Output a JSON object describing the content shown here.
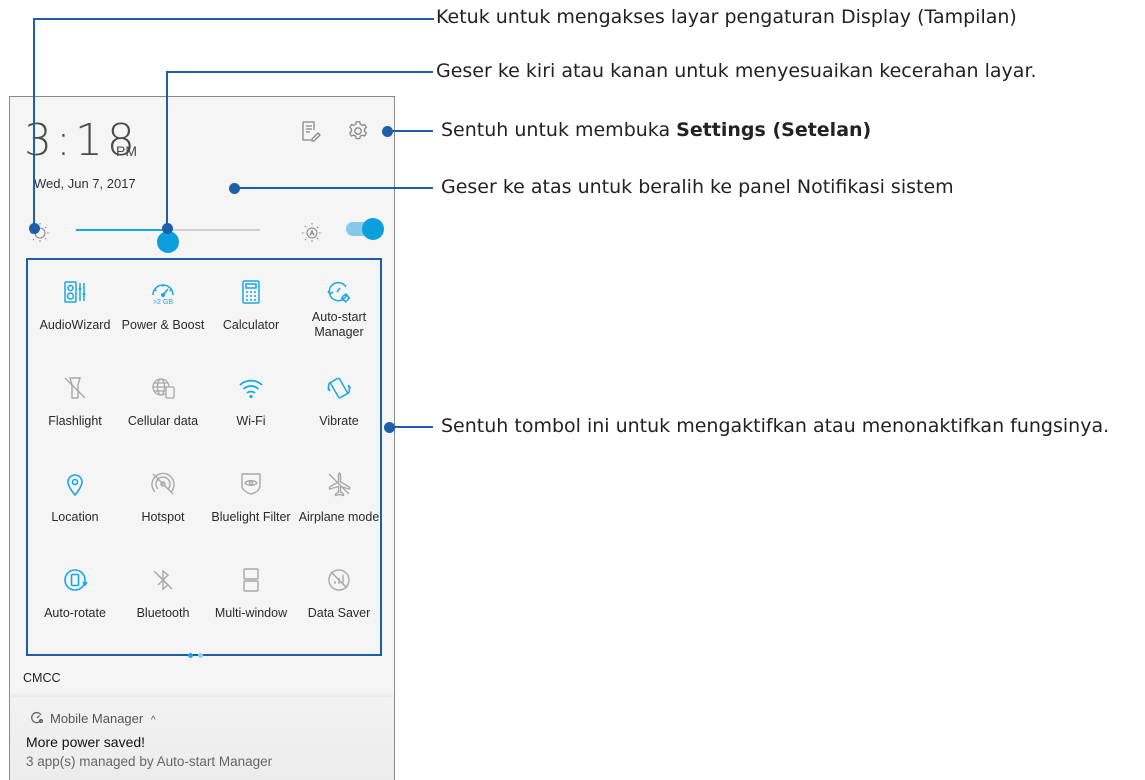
{
  "status": {
    "time": "3:18",
    "ampm": "PM",
    "date": "Wed, Jun 7, 2017"
  },
  "top_icons": [
    "edit-notes-icon",
    "settings-gear-icon"
  ],
  "brightness": {
    "level": 0.5,
    "auto_icon": "auto-brightness-icon",
    "auto_enabled": true
  },
  "tiles": [
    {
      "label": "AudioWizard",
      "icon": "audiowizard-icon",
      "active": true
    },
    {
      "label": "Power & Boost",
      "icon": "power-boost-icon",
      "active": true,
      "sub": ">2 GB"
    },
    {
      "label": "Calculator",
      "icon": "calculator-icon",
      "active": true
    },
    {
      "label": "Auto-start Manager",
      "icon": "autostart-manager-icon",
      "active": true
    },
    {
      "label": "Flashlight",
      "icon": "flashlight-icon",
      "active": false
    },
    {
      "label": "Cellular data",
      "icon": "cellular-data-icon",
      "active": false
    },
    {
      "label": "Wi-Fi",
      "icon": "wifi-icon",
      "active": true
    },
    {
      "label": "Vibrate",
      "icon": "vibrate-icon",
      "active": true
    },
    {
      "label": "Location",
      "icon": "location-icon",
      "active": true
    },
    {
      "label": "Hotspot",
      "icon": "hotspot-icon",
      "active": false
    },
    {
      "label": "Bluelight Filter",
      "icon": "bluelight-filter-icon",
      "active": false
    },
    {
      "label": "Airplane mode",
      "icon": "airplane-icon",
      "active": false
    },
    {
      "label": "Auto-rotate",
      "icon": "auto-rotate-icon",
      "active": true
    },
    {
      "label": "Bluetooth",
      "icon": "bluetooth-icon",
      "active": false
    },
    {
      "label": "Multi-window",
      "icon": "multi-window-icon",
      "active": false
    },
    {
      "label": "Data Saver",
      "icon": "data-saver-icon",
      "active": false
    }
  ],
  "pager": {
    "pages": 2,
    "current": 1
  },
  "carrier": "CMCC",
  "notification": {
    "app": "Mobile Manager",
    "title": "More power saved!",
    "text": "3 app(s) managed by Auto-start Manager"
  },
  "callouts": {
    "display": "Ketuk untuk mengakses layar pengaturan Display (Tampilan)",
    "brightness": "Geser ke kiri atau kanan untuk menyesuaikan kecerahan layar.",
    "settings_prefix": "Sentuh untuk membuka ",
    "settings_bold": "Settings (Setelan)",
    "swipe_up": "Geser ke atas untuk beralih ke panel Notifikasi sistem",
    "toggle": "Sentuh tombol ini untuk mengaktifkan atau menonaktifkan fungsinya."
  },
  "colors": {
    "accent": "#0b9fe0",
    "icon_active": "#1aa6e5",
    "icon_inactive": "#a8a8a8",
    "callout_line": "#1f5fa8"
  }
}
